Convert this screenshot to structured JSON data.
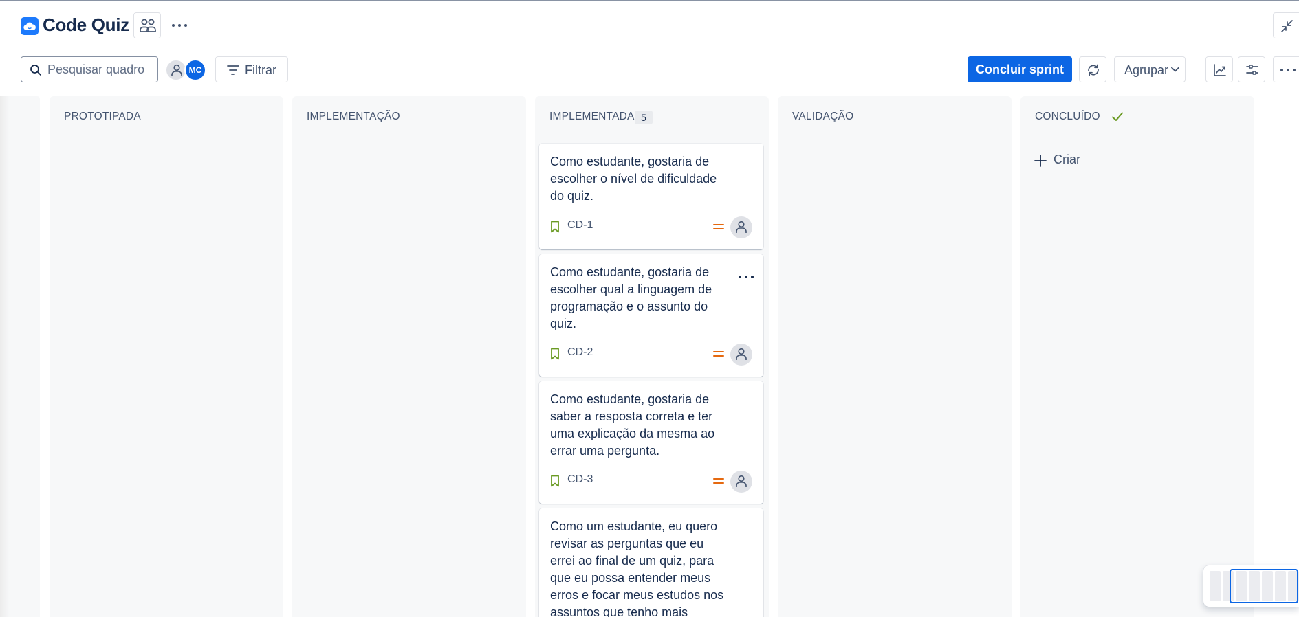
{
  "header": {
    "project_title": "Code Quiz",
    "project_logo_icon": "cloud-icon",
    "team_icon": "people-icon",
    "more_icon": "ellipsis-icon",
    "collapse_icon": "minimize-icon"
  },
  "toolbar": {
    "search_placeholder": "Pesquisar quadro",
    "avatar_initials": "MC",
    "filter_label": "Filtrar",
    "complete_sprint_label": "Concluir sprint",
    "group_label": "Agrupar",
    "accent_color": "#0c66e4"
  },
  "columns": [
    {
      "title": "PROTOTIPADA"
    },
    {
      "title": "IMPLEMENTAÇÃO"
    },
    {
      "title": "IMPLEMENTADA",
      "count": "5"
    },
    {
      "title": "VALIDAÇÃO"
    },
    {
      "title": "CONCLUÍDO",
      "create_label": "Criar"
    }
  ],
  "cards": [
    {
      "text": "Como estudante, gostaria de escolher o nível de dificuldade do quiz.",
      "key": "CD-1",
      "priority": "medium"
    },
    {
      "text": "Como estudante, gostaria de escolher qual a linguagem de programação e o assunto do quiz.",
      "key": "CD-2",
      "priority": "medium"
    },
    {
      "text": "Como estudante, gostaria de saber a resposta correta e ter uma explicação da mesma ao errar uma pergunta.",
      "key": "CD-3",
      "priority": "medium"
    },
    {
      "text": "Como um estudante, eu quero revisar as perguntas que eu errei ao final de um quiz, para que eu possa entender meus erros e focar meus estudos nos assuntos que tenho mais"
    }
  ]
}
